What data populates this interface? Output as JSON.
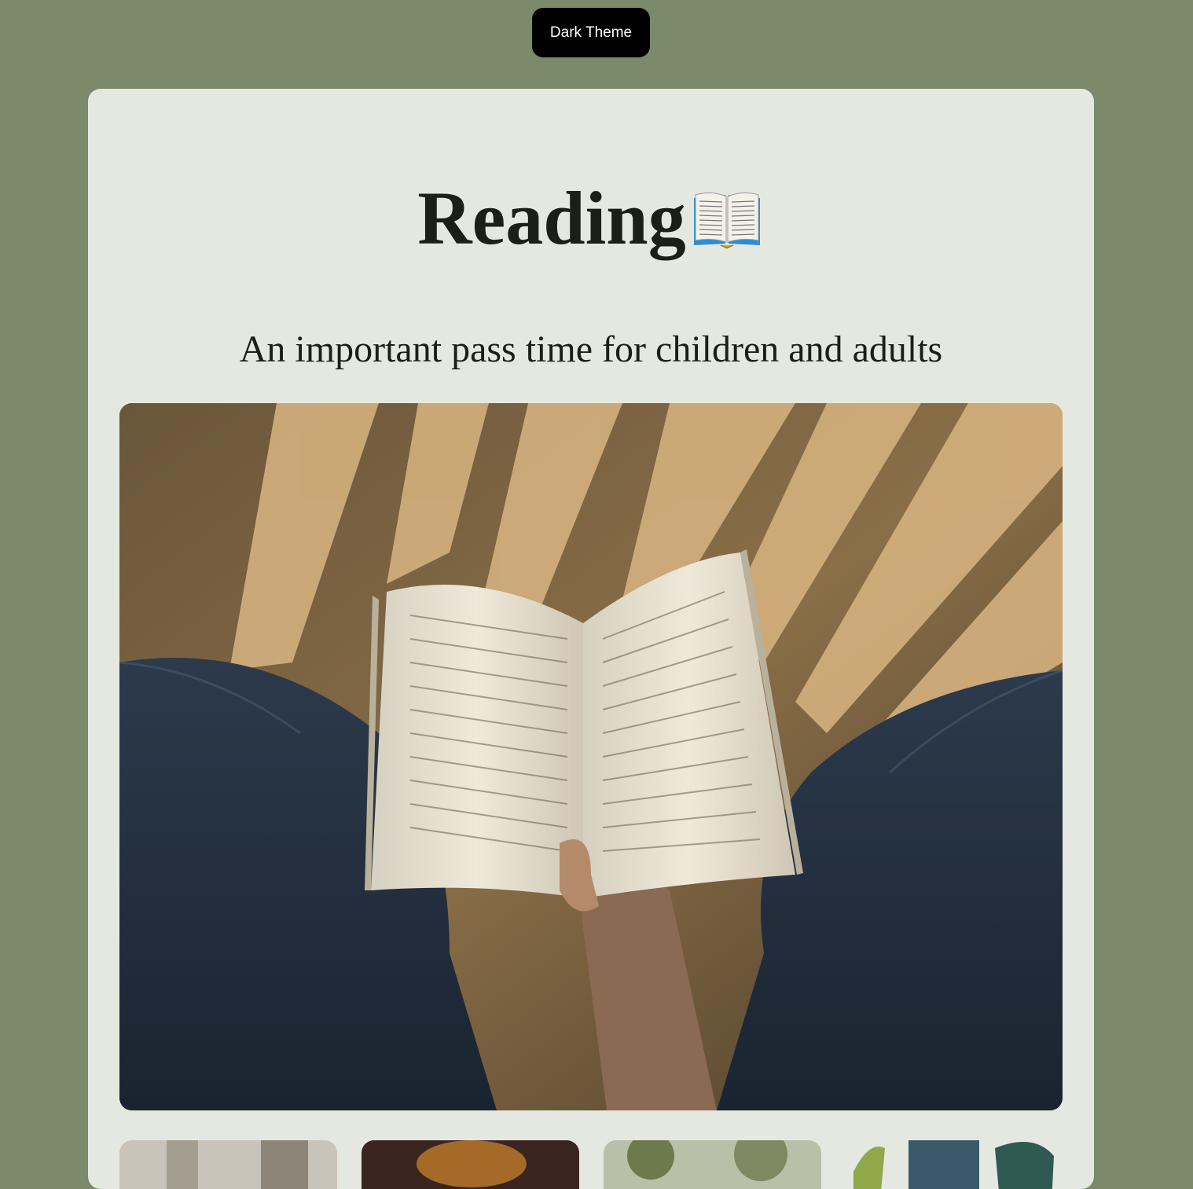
{
  "theme_toggle": {
    "label": "Dark Theme"
  },
  "header": {
    "title": "Reading",
    "title_icon": "open-book-icon",
    "subtitle": "An important pass time for children and adults"
  },
  "hero_image": {
    "icon": "person-reading-book-photo"
  },
  "gallery": {
    "thumbnails": [
      {
        "icon": "gallery-photo-1"
      },
      {
        "icon": "gallery-photo-2"
      },
      {
        "icon": "gallery-photo-3"
      },
      {
        "icon": "gallery-photo-4"
      }
    ]
  },
  "colors": {
    "page_background": "#7a8a6a",
    "card_background": "#e5e8e1",
    "button_background": "#000000",
    "text": "#1b1f18"
  }
}
